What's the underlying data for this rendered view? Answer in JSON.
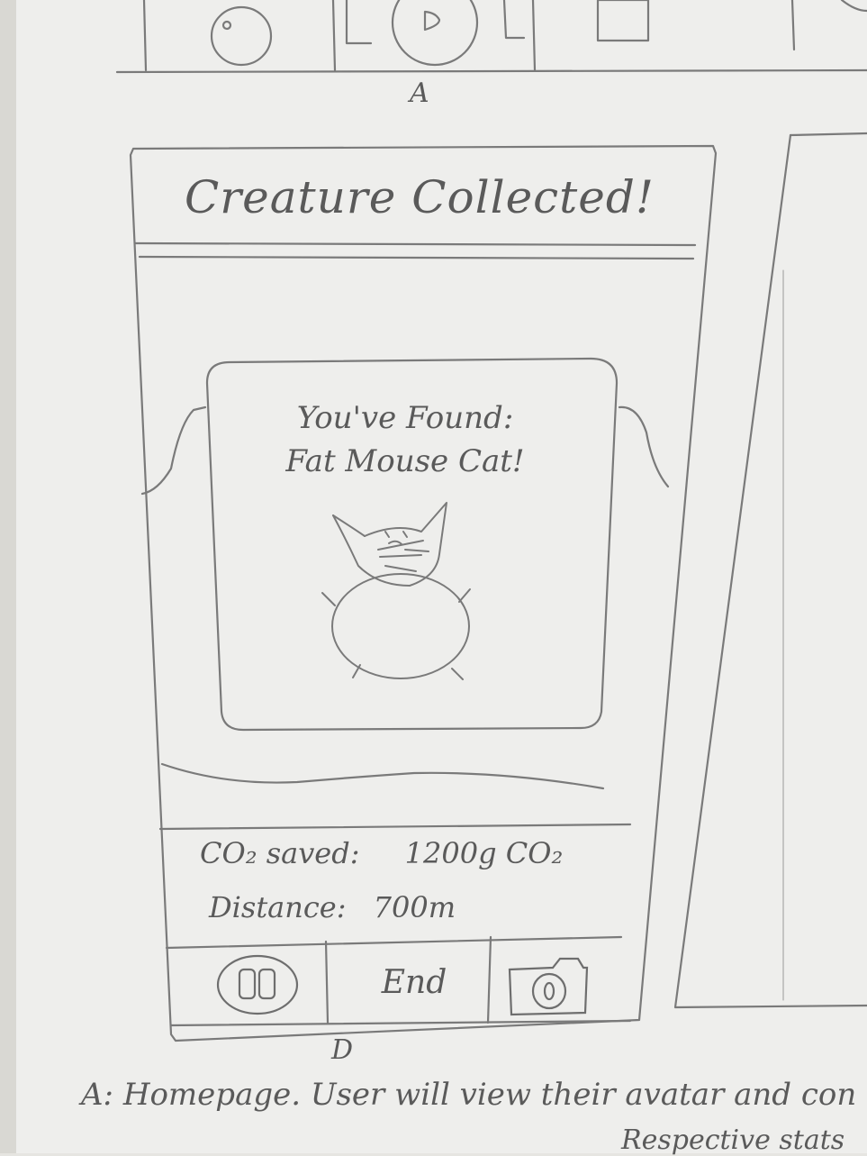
{
  "top_strip": {
    "label": "A"
  },
  "screen": {
    "title": "Creature Collected!",
    "card": {
      "line1": "You've Found:",
      "line2": "Fat Mouse Cat!"
    },
    "stats": {
      "co2_label": "CO₂ saved:",
      "co2_value": "1200g CO₂",
      "distance_label": "Distance:",
      "distance_value": "700m"
    },
    "tabbar": {
      "end_label": "End"
    },
    "label": "D"
  },
  "notes": {
    "line1": "A: Homepage. User will view their avatar and con",
    "line2": "Respective stats"
  }
}
